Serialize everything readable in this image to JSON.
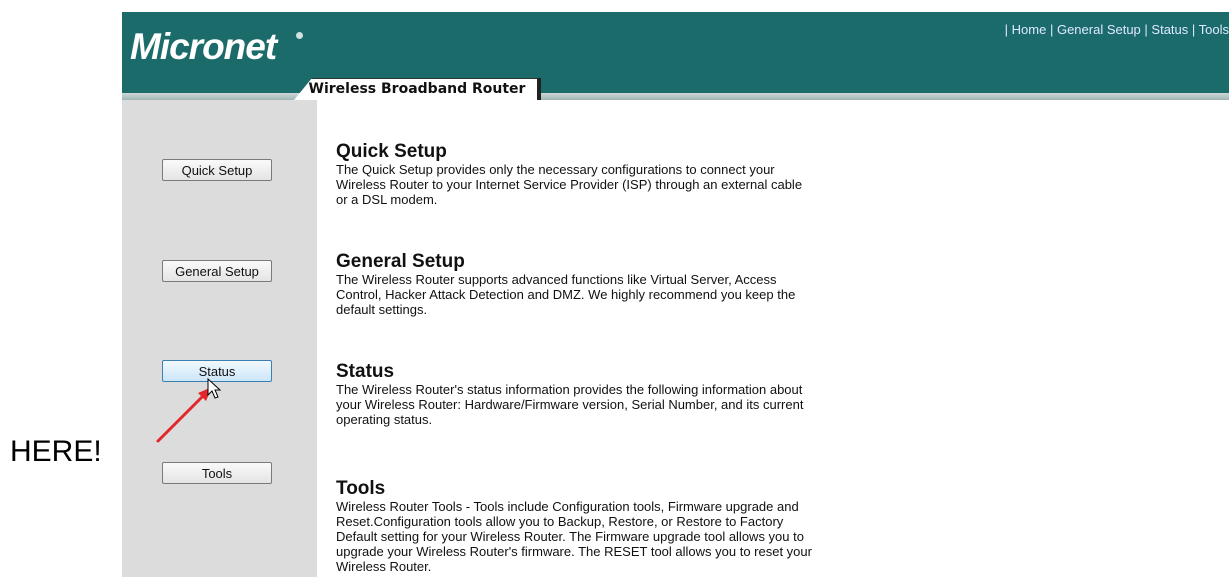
{
  "header": {
    "logo_text": "Micronet",
    "product_name": "Wireless Broadband Router",
    "top_links": [
      "Home",
      "General Setup",
      "Status",
      "Tools"
    ],
    "background_color": "#1b6b6b"
  },
  "sidebar": {
    "buttons": [
      {
        "label": "Quick Setup"
      },
      {
        "label": "General Setup"
      },
      {
        "label": "Status",
        "state": "hover"
      },
      {
        "label": "Tools"
      }
    ]
  },
  "sections": [
    {
      "title": "Quick Setup",
      "description": "The Quick Setup provides only the necessary configurations to connect your Wireless Router to your Internet Service Provider (ISP) through an external cable or a DSL modem."
    },
    {
      "title": "General Setup",
      "description": "The Wireless Router supports advanced functions like Virtual Server, Access Control, Hacker Attack Detection and DMZ. We highly recommend you keep the default settings."
    },
    {
      "title": "Status",
      "description": "The Wireless Router's status information provides the following information about your Wireless Router: Hardware/Firmware version, Serial Number, and its current operating status."
    },
    {
      "title": "Tools",
      "description": "Wireless Router Tools - Tools include Configuration tools, Firmware upgrade and Reset.Configuration tools allow you to Backup, Restore, or Restore to Factory Default setting for your Wireless Router. The Firmware upgrade tool allows you to upgrade your Wireless Router's firmware. The RESET tool allows you to reset your Wireless Router."
    }
  ],
  "annotation": {
    "text": "HERE!",
    "arrow_color": "#e3262b"
  }
}
